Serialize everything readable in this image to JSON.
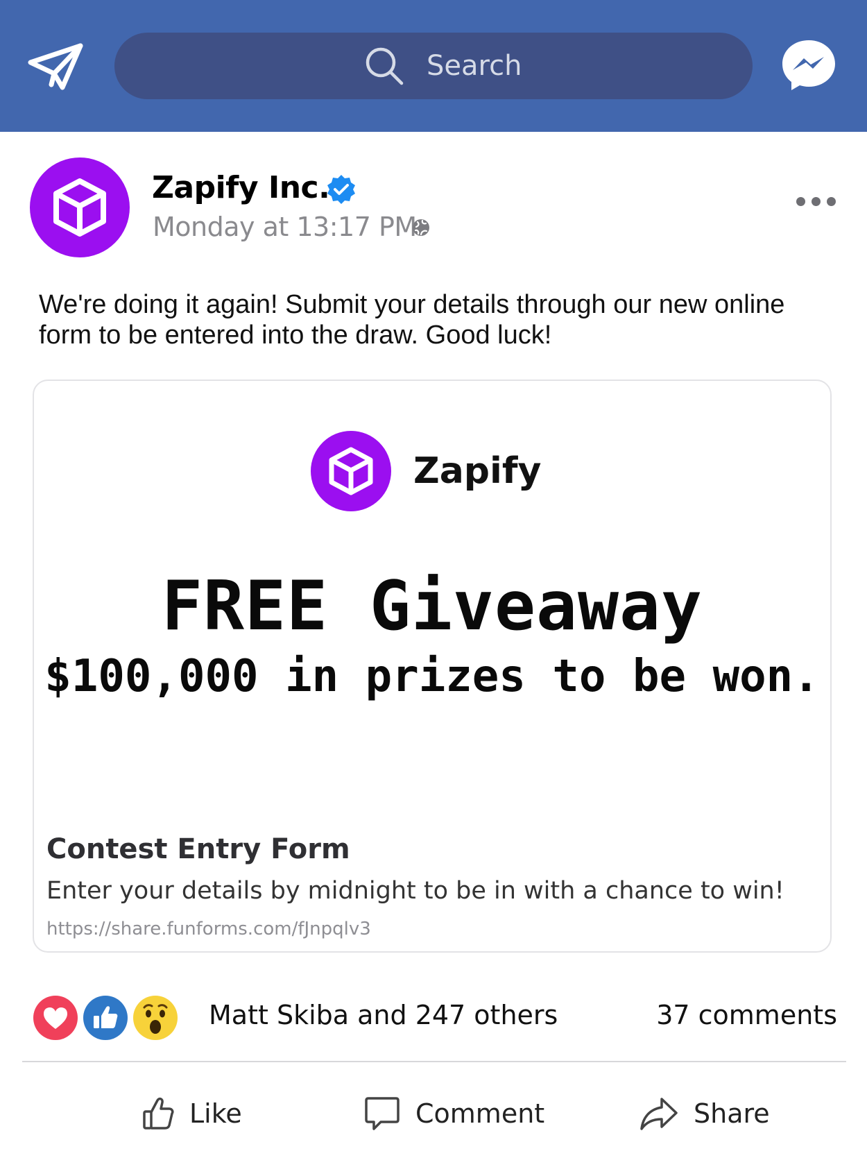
{
  "header": {
    "search_placeholder": "Search"
  },
  "post": {
    "author": "Zapify Inc.",
    "timestamp": "Monday at 13:17 PM",
    "text": "We're doing it again! Submit your details through our new online form to be entered into the draw. Good luck!"
  },
  "link_card": {
    "brand_name": "Zapify",
    "headline": "FREE Giveaway",
    "subheadline": "$100,000 in prizes to be won.",
    "title": "Contest Entry Form",
    "description": "Enter your details by midnight to be in with a chance to win!",
    "url": "https://share.funforms.com/fJnpqlv3"
  },
  "engagement": {
    "reactions": [
      "love-icon",
      "like-icon",
      "wow-icon"
    ],
    "reactors_text": "Matt Skiba and 247 others",
    "comments_text": "37 comments"
  },
  "actions": {
    "like": "Like",
    "comment": "Comment",
    "share": "Share"
  },
  "colors": {
    "header_bg": "#4267ae",
    "search_bg": "#3f5086",
    "brand_purple": "#9b0ff0",
    "verified_blue": "#1d8cf2",
    "love_red": "#f0405a",
    "like_blue": "#2f78c7",
    "wow_yellow": "#f7d23a"
  }
}
